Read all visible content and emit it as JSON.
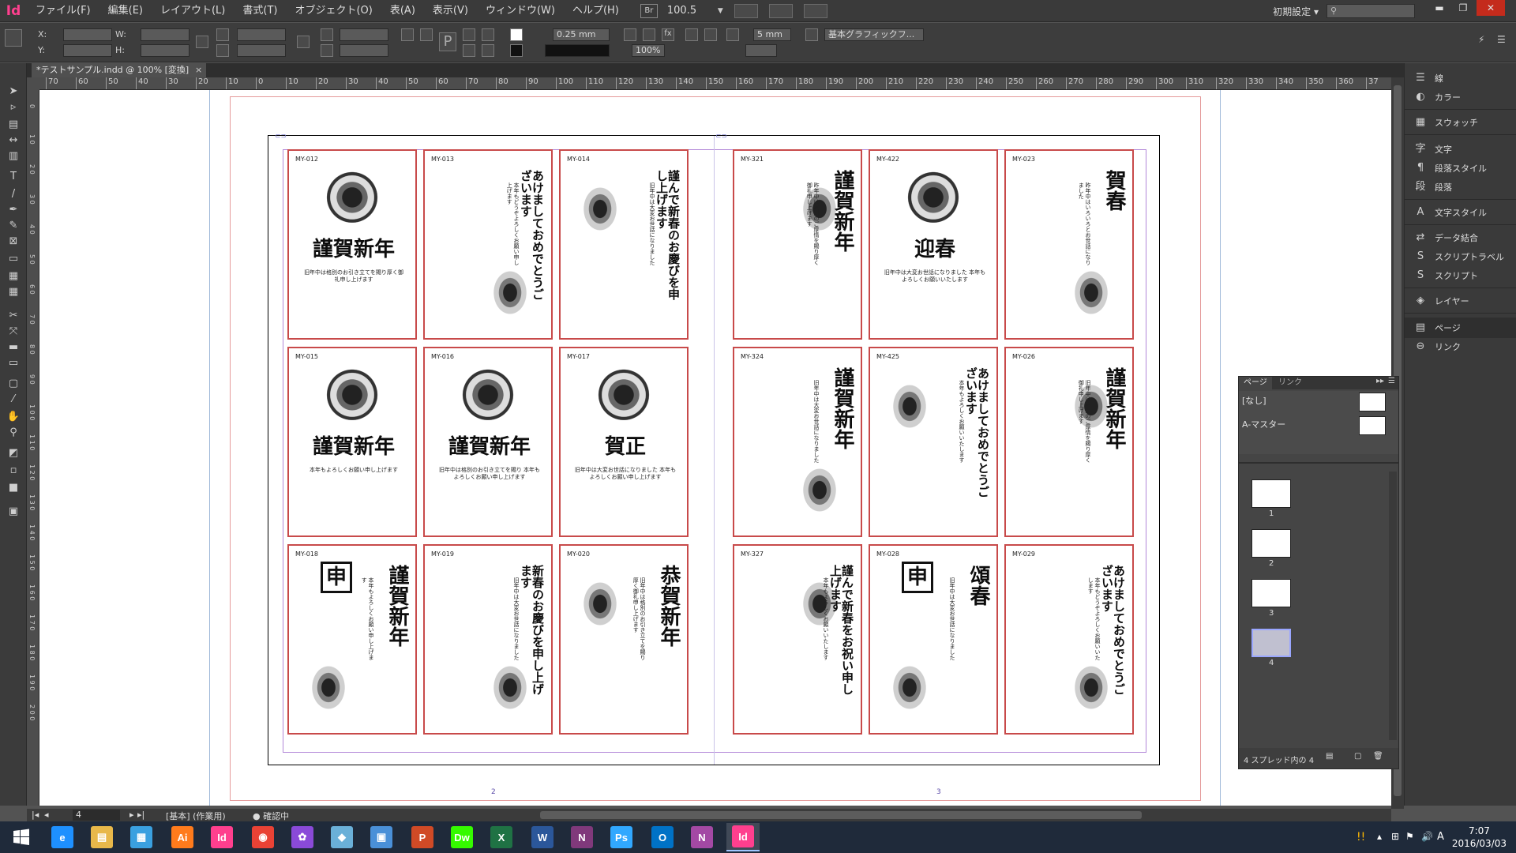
{
  "app": {
    "logo": "Id",
    "brand_color": "#ff3f8e"
  },
  "menu": [
    "ファイル(F)",
    "編集(E)",
    "レイアウト(L)",
    "書式(T)",
    "オブジェクト(O)",
    "表(A)",
    "表示(V)",
    "ウィンドウ(W)",
    "ヘルプ(H)"
  ],
  "menubar": {
    "bridge": "Br",
    "zoom": "100.5",
    "workspace": "初期設定",
    "search_placeholder": ""
  },
  "window_controls": {
    "minimize": "▬",
    "restore": "❐",
    "close": "✕"
  },
  "control": {
    "x_label": "X:",
    "y_label": "Y:",
    "w_label": "W:",
    "h_label": "H:",
    "stroke_weight": "0.25 mm",
    "scale_pct": "100%",
    "gap": "5 mm",
    "frame_style": "基本グラフィックフ..."
  },
  "document_tab": {
    "title": "*テストサンプル.indd @ 100% [変換]",
    "close": "×"
  },
  "ruler_h": [
    "70",
    "60",
    "50",
    "40",
    "30",
    "20",
    "10",
    "0",
    "10",
    "20",
    "30",
    "40",
    "50",
    "60",
    "70",
    "80",
    "90",
    "100",
    "110",
    "120",
    "130",
    "140",
    "150",
    "160",
    "170",
    "180",
    "190",
    "200",
    "210",
    "220",
    "230",
    "240",
    "250",
    "260",
    "270",
    "280",
    "290",
    "300",
    "310",
    "320",
    "330",
    "340",
    "350",
    "360",
    "37"
  ],
  "ruler_v": [
    "0",
    "1 0",
    "2 0",
    "3 0",
    "4 0",
    "5 0",
    "6 0",
    "7 0",
    "8 0",
    "9 0",
    "1 0 0",
    "1 1 0",
    "1 2 0",
    "1 3 0",
    "1 4 0",
    "1 5 0",
    "1 6 0",
    "1 7 0",
    "1 8 0",
    "1 9 0",
    "2 0 0"
  ],
  "cards": [
    {
      "code": "MY-012",
      "title": "謹賀新年",
      "orient": "h",
      "body": "旧年中は格別のお引き立てを賜り厚く御礼申し上げます"
    },
    {
      "code": "MY-013",
      "title": "あけましておめでとうございます",
      "orient": "v",
      "body": "本年もどうぞよろしくお願い申し上げます"
    },
    {
      "code": "MY-014",
      "title": "謹んで新春のお慶びを申し上げます",
      "orient": "v",
      "body": "旧年中は大変お世話になりました"
    },
    {
      "code": "MY-321",
      "title": "謹賀新年",
      "orient": "v",
      "body": "昨年中は格別のご厚情を賜り厚く御礼申し上げます"
    },
    {
      "code": "MY-422",
      "title": "迎春",
      "orient": "h",
      "body": "旧年中は大変お世話になりました 本年もよろしくお願いいたします"
    },
    {
      "code": "MY-023",
      "title": "賀春",
      "orient": "v",
      "body": "昨年中はいろいろとお世話になりました"
    },
    {
      "code": "MY-015",
      "title": "謹賀新年",
      "orient": "h",
      "body": "本年もよろしくお願い申し上げます"
    },
    {
      "code": "MY-016",
      "title": "謹賀新年",
      "orient": "h",
      "body": "旧年中は格別のお引き立てを賜り 本年もよろしくお願い申し上げます"
    },
    {
      "code": "MY-017",
      "title": "賀正",
      "orient": "h",
      "body": "旧年中は大変お世話になりました 本年もよろしくお願い申し上げます"
    },
    {
      "code": "MY-324",
      "title": "謹賀新年",
      "orient": "v",
      "body": "旧年中は大変お世話になりました"
    },
    {
      "code": "MY-425",
      "title": "あけましておめでとうございます",
      "orient": "v",
      "body": "本年もよろしくお願いいたします"
    },
    {
      "code": "MY-026",
      "title": "謹賀新年",
      "orient": "v",
      "body": "旧年中は格別のご厚情を賜り厚く御礼申し上げます"
    },
    {
      "code": "MY-018",
      "title": "謹賀新年",
      "orient": "v",
      "body": "本年もよろしくお願い申し上げます",
      "stamp": "申"
    },
    {
      "code": "MY-019",
      "title": "新春のお慶びを申し上げます",
      "orient": "v",
      "body": "旧年中は大変お世話になりました"
    },
    {
      "code": "MY-020",
      "title": "恭賀新年",
      "orient": "v",
      "body": "旧年中は格別のお引き立てを賜り厚く御礼申し上げます"
    },
    {
      "code": "MY-327",
      "title": "謹んで新春をお祝い申し上げます",
      "orient": "v",
      "body": "本年もよろしくお願いいたします"
    },
    {
      "code": "MY-028",
      "title": "頌春",
      "orient": "v",
      "body": "旧年中は大変お世話になりました",
      "stamp": "申"
    },
    {
      "code": "MY-029",
      "title": "あけましておめでとうございます",
      "orient": "v",
      "body": "本年もどうぞよろしくお願いいたします"
    }
  ],
  "spread_pages": [
    "2",
    "3"
  ],
  "status": {
    "page": "4",
    "master": "[基本] (作業用)",
    "preflight": "確認中"
  },
  "dock": [
    {
      "icon": "stroke-icon",
      "glyph": "☰",
      "label": "線"
    },
    {
      "icon": "color-icon",
      "glyph": "◐",
      "label": "カラー"
    },
    {
      "icon": "swatches-icon",
      "glyph": "▦",
      "label": "スウォッチ"
    },
    {
      "icon": "character-icon",
      "glyph": "字",
      "label": "文字"
    },
    {
      "icon": "paragraph-style-icon",
      "glyph": "¶",
      "label": "段落スタイル"
    },
    {
      "icon": "paragraph-icon",
      "glyph": "段",
      "label": "段落"
    },
    {
      "icon": "character-style-icon",
      "glyph": "A",
      "label": "文字スタイル"
    },
    {
      "icon": "data-merge-icon",
      "glyph": "⇄",
      "label": "データ結合"
    },
    {
      "icon": "script-label-icon",
      "glyph": "S",
      "label": "スクリプトラベル"
    },
    {
      "icon": "script-icon",
      "glyph": "S",
      "label": "スクリプト"
    },
    {
      "icon": "layers-icon",
      "glyph": "◈",
      "label": "レイヤー"
    },
    {
      "icon": "pages-icon",
      "glyph": "▤",
      "label": "ページ"
    },
    {
      "icon": "links-icon",
      "glyph": "⊖",
      "label": "リンク"
    }
  ],
  "pages_panel": {
    "tab_pages": "ページ",
    "tab_links": "リンク",
    "master_none": "[なし]",
    "master_a": "A-マスター",
    "thumb_nums": [
      "1",
      "2",
      "3",
      "4"
    ],
    "footer": "4 スプレッド内の 4"
  },
  "taskbar": [
    {
      "name": "internet-explorer",
      "label": "e",
      "color": "#1e90ff"
    },
    {
      "name": "file-explorer",
      "label": "▤",
      "color": "#e8b84a"
    },
    {
      "name": "store",
      "label": "▦",
      "color": "#3aa0e0"
    },
    {
      "name": "illustrator",
      "label": "Ai",
      "color": "#ff7b1c"
    },
    {
      "name": "indesign",
      "label": "Id",
      "color": "#ff3f8e"
    },
    {
      "name": "chrome",
      "label": "◉",
      "color": "#e94235"
    },
    {
      "name": "photo-app",
      "label": "✿",
      "color": "#8a4ad8"
    },
    {
      "name": "paint",
      "label": "◆",
      "color": "#6ab0d8"
    },
    {
      "name": "network",
      "label": "▣",
      "color": "#4a90d8"
    },
    {
      "name": "powerpoint",
      "label": "P",
      "color": "#d04a26"
    },
    {
      "name": "dreamweaver",
      "label": "Dw",
      "color": "#35fa00"
    },
    {
      "name": "excel",
      "label": "X",
      "color": "#1f7244"
    },
    {
      "name": "word",
      "label": "W",
      "color": "#2b579a"
    },
    {
      "name": "onenote",
      "label": "N",
      "color": "#80397b"
    },
    {
      "name": "photoshop",
      "label": "Ps",
      "color": "#31a8ff"
    },
    {
      "name": "outlook",
      "label": "O",
      "color": "#0072c6"
    },
    {
      "name": "onenote-2",
      "label": "N",
      "color": "#a349a4"
    },
    {
      "name": "indesign-2",
      "label": "Id",
      "color": "#ff3f8e"
    }
  ],
  "clock": {
    "time": "7:07",
    "date": "2016/03/03",
    "ime": "A"
  }
}
